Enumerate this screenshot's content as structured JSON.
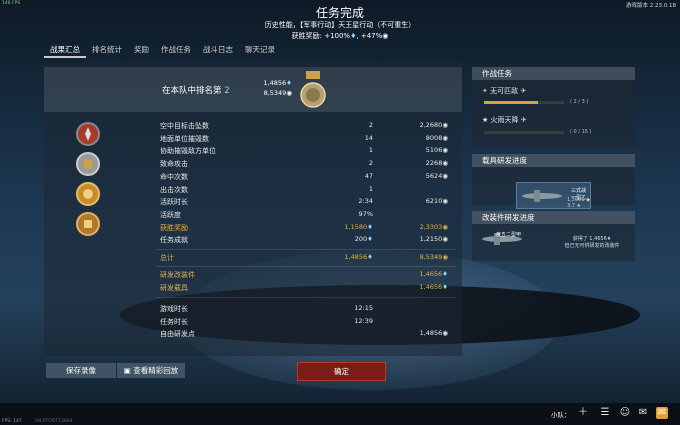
{
  "top": {
    "fps": "148 FPS",
    "version": "游戏版本 2.23.0.18"
  },
  "header": {
    "title": "任务完成",
    "subtitle": "历史性能，【军事行动】天王星行动（不可重生）",
    "reward_label": "获胜奖励: +100%",
    "reward_extra": ", +47%"
  },
  "tabs": [
    "战果汇总",
    "排名统计",
    "奖励",
    "作战任务",
    "战斗日志",
    "聊天记录"
  ],
  "rank": {
    "label": "在本队中排名第",
    "number": "2",
    "value1": "1,4856",
    "value2": "8,5349"
  },
  "stats": [
    {
      "label": "空中目标击坠数",
      "v1": "2",
      "v2": "2,2680"
    },
    {
      "label": "地面单位摧毁数",
      "v1": "14",
      "v2": "8008"
    },
    {
      "label": "协助摧毁敌方单位",
      "v1": "1",
      "v2": "5106"
    },
    {
      "label": "致命攻击",
      "v1": "2",
      "v2": "2268"
    },
    {
      "label": "命中次数",
      "v1": "47",
      "v2": "5624"
    },
    {
      "label": "出击次数",
      "v1": "1",
      "v2": ""
    },
    {
      "label": "活跃时长",
      "v1": "2:34",
      "v2": "6210"
    },
    {
      "label": "活跃度",
      "v1": "97%",
      "v2": ""
    },
    {
      "label": "获胜奖励",
      "v1": "1,1580",
      "v2": "2,3303"
    },
    {
      "label": "任务成就",
      "v1": "200",
      "v2": "1,2150"
    }
  ],
  "totals": {
    "label": "总计",
    "v1": "1,4856",
    "v2": "8,5349"
  },
  "research": [
    {
      "label": "研发改装件",
      "v2": "1,4656"
    },
    {
      "label": "研发载具",
      "v2": "1,4656"
    }
  ],
  "times": [
    {
      "label": "游戏时长",
      "v1": "12:15",
      "v2": ""
    },
    {
      "label": "任务时长",
      "v1": "12:39",
      "v2": ""
    },
    {
      "label": "自由研发点",
      "v1": "",
      "v2": "1,4856"
    }
  ],
  "missions_panel": {
    "title": "作战任务",
    "items": [
      {
        "name": "无可匹敌",
        "count": "( 2 / 3 )",
        "progress": 0.67
      },
      {
        "name": "火雨天降",
        "count": "( 0 / 15 )",
        "progress": 0.0
      }
    ]
  },
  "vehicle_panel": {
    "title": "载具研发进度",
    "vehicle_name": "三式战一型乙",
    "stats": "1,5000 ◆ 3.7 ★"
  },
  "mod_panel": {
    "title": "改装件研发进度",
    "vehicle_name": "疾五二型甲",
    "gained": "获得了 1,4656",
    "note": "但已无可供研发的改装件"
  },
  "buttons": {
    "save": "保存录像",
    "replay": "查看精彩回放",
    "ok": "确定"
  },
  "bottom": {
    "fps": "FPS: 147",
    "server": "SN:RTOOT13894",
    "squad": "小队："
  },
  "colors": {
    "accent": "#8fd0ff",
    "gold": "#e0b04c",
    "ok_button": "#7a1d16"
  }
}
